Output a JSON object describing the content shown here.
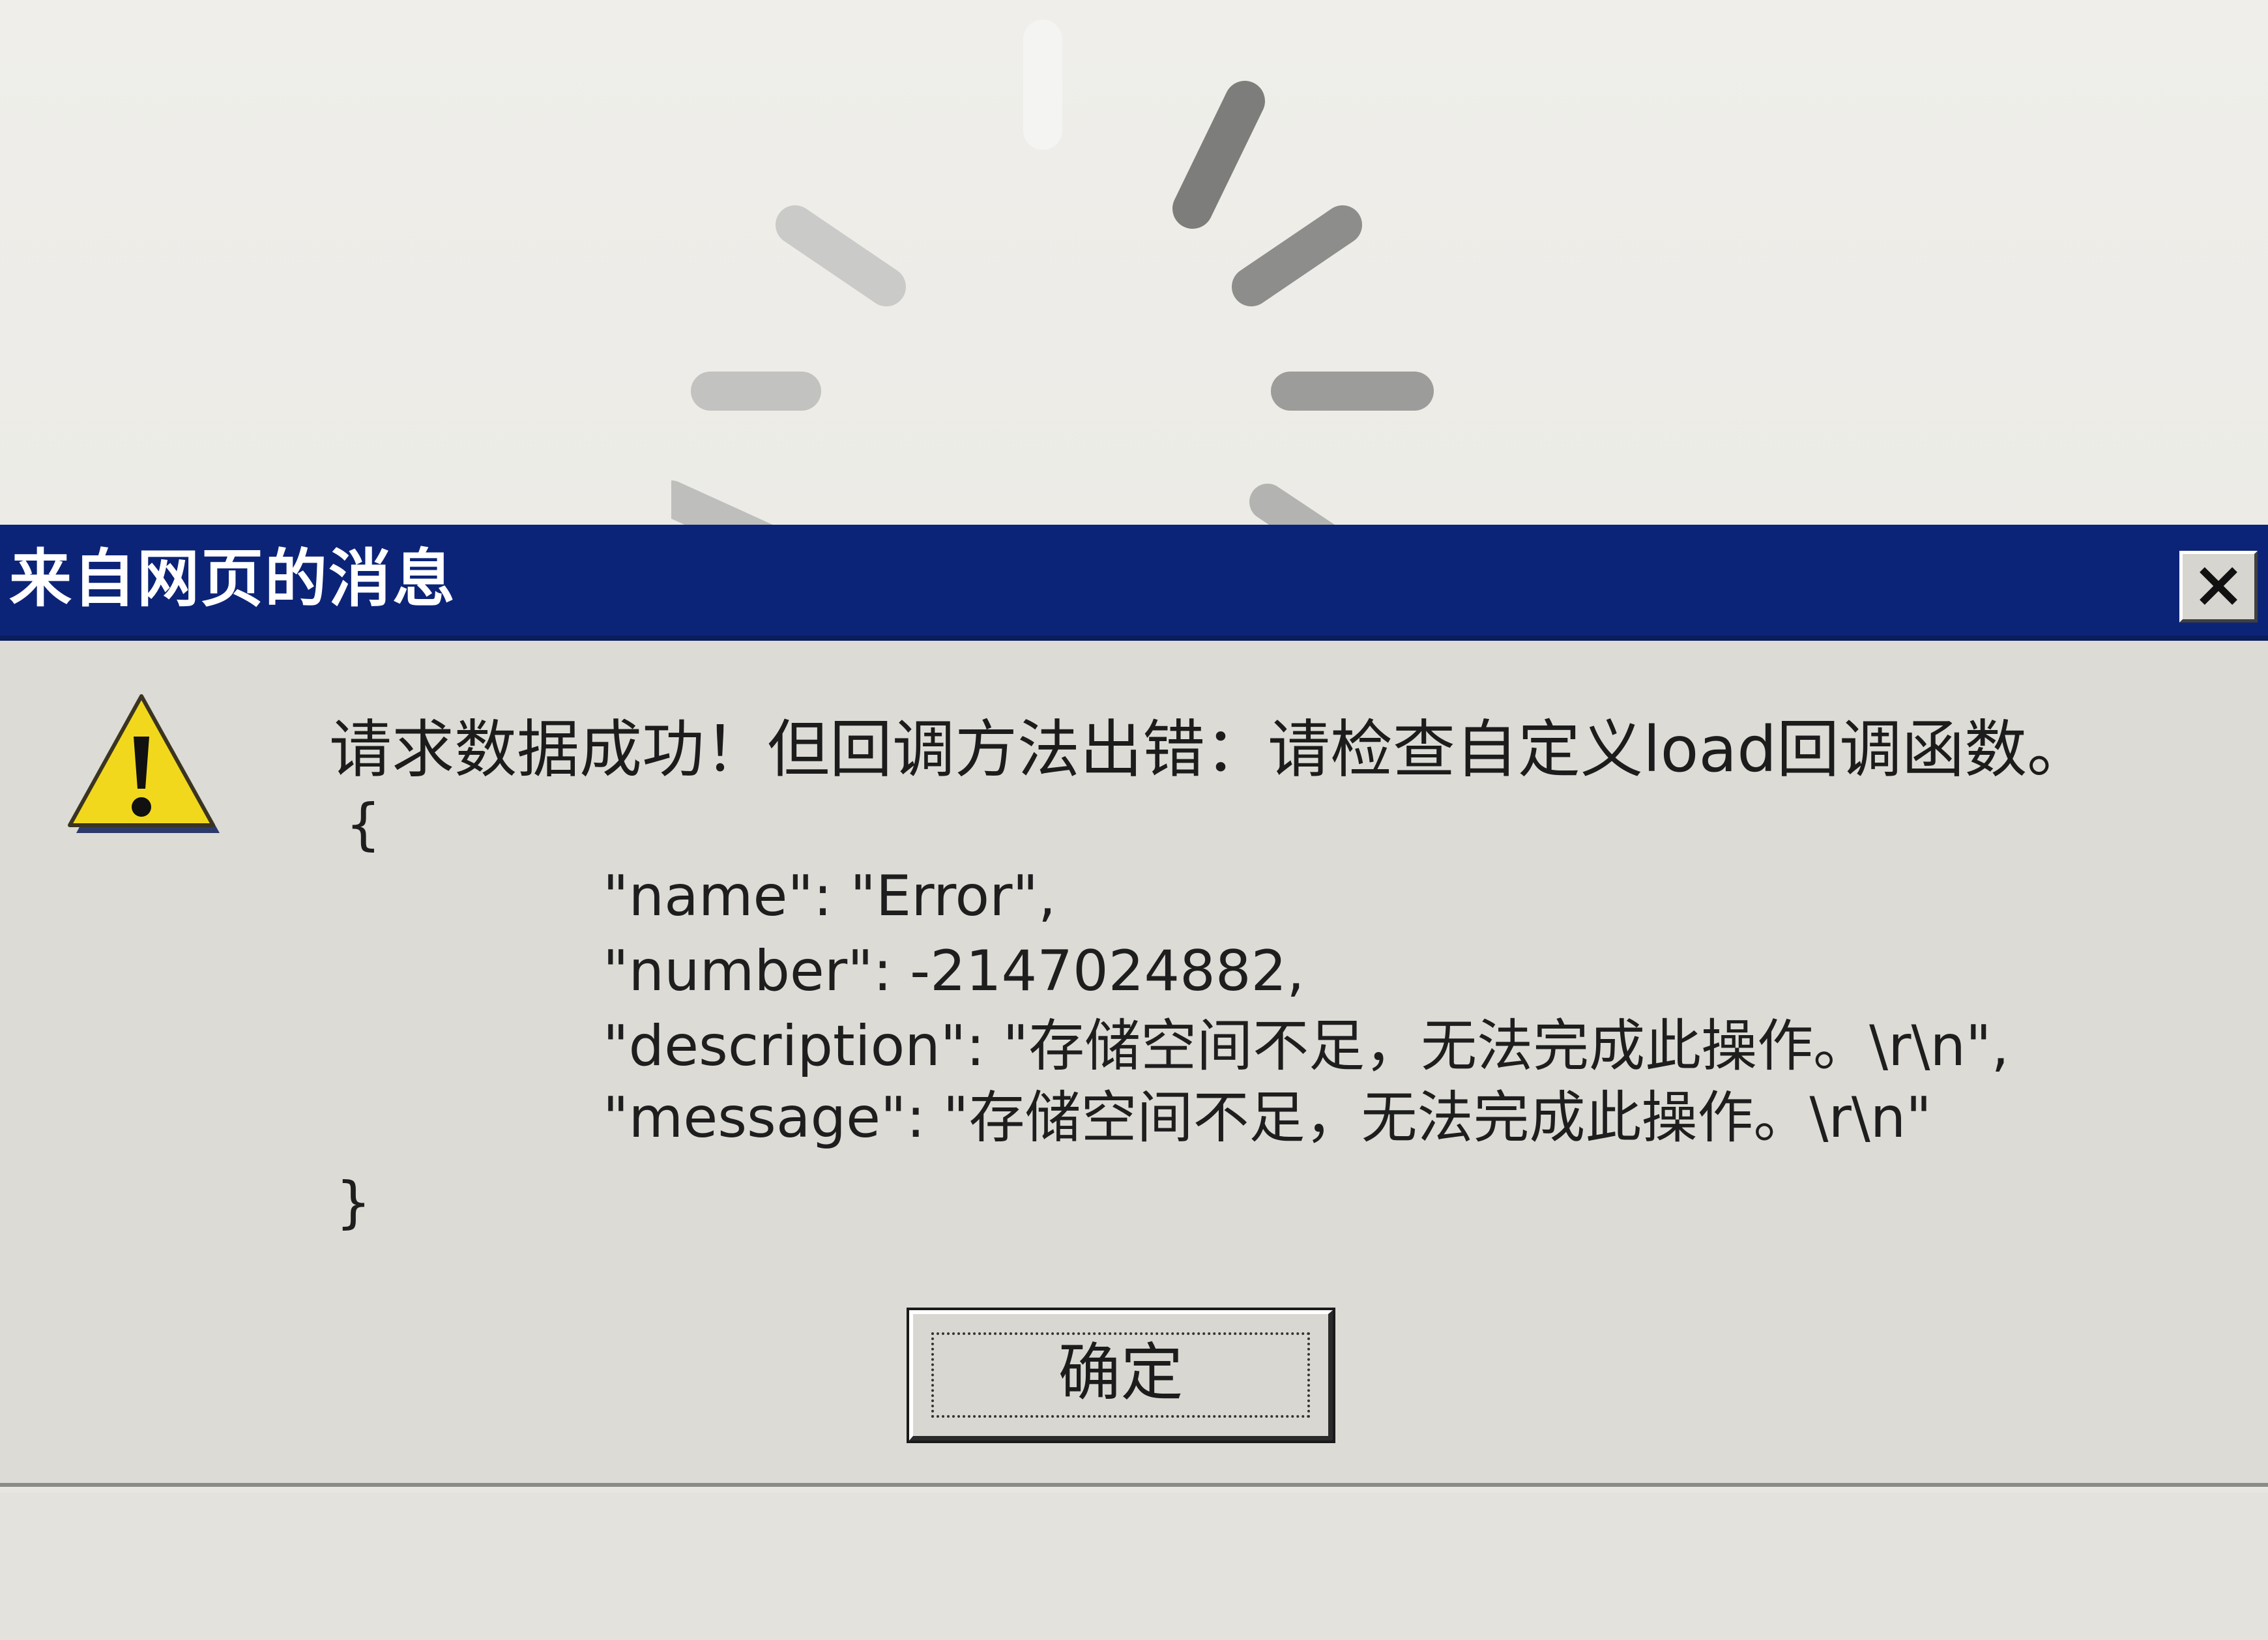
{
  "dialog": {
    "title": "来自网页的消息",
    "headline": "请求数据成功！但回调方法出错：请检查自定义load回调函数。",
    "brace_open": "{",
    "lines": [
      "\"name\": \"Error\",",
      "\"number\": -2147024882,",
      "\"description\": \"存储空间不足，无法完成此操作。\\r\\n\",",
      "\"message\": \"存储空间不足，无法完成此操作。\\r\\n\""
    ],
    "brace_close": "}",
    "ok_label": "确定"
  },
  "icons": {
    "close": "close-icon",
    "warning": "warning-icon",
    "spinner": "loading-spinner-icon"
  },
  "colors": {
    "titlebar": "#0c2478",
    "dialog_bg": "#dcdbd5",
    "warning_yellow": "#f2d81c",
    "spinner_gray": "#9a9a98"
  }
}
